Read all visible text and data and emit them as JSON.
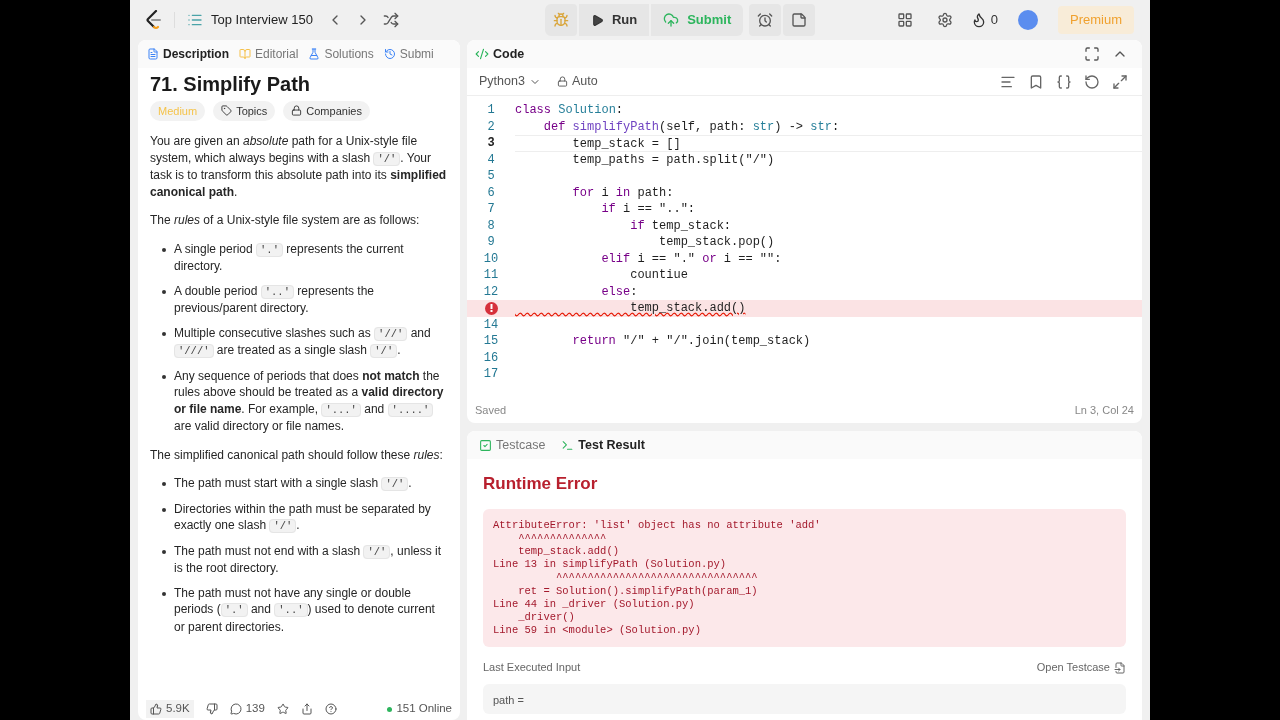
{
  "topbar": {
    "list_title": "Top Interview 150",
    "run": "Run",
    "submit": "Submit",
    "streak": "0",
    "premium": "Premium"
  },
  "description_panel": {
    "tabs": [
      {
        "label": "Description",
        "selected": true
      },
      {
        "label": "Editorial",
        "selected": false
      },
      {
        "label": "Solutions",
        "selected": false
      },
      {
        "label": "Submi",
        "selected": false
      }
    ],
    "title": "71. Simplify Path",
    "tags": [
      {
        "kind": "difficulty",
        "label": "Medium"
      },
      {
        "kind": "topics",
        "label": "Topics"
      },
      {
        "kind": "companies",
        "label": "Companies"
      }
    ],
    "blocks": [
      {
        "kind": "paragraph",
        "segments": [
          {
            "kind": "text",
            "text": "You are given an *absolute* path for a Unix-style file system, which always begins with a slash "
          },
          {
            "kind": "code",
            "text": "'/'"
          },
          {
            "kind": "text",
            "text": ". Your task is to transform this absolute path into its **simplified canonical path**."
          }
        ]
      },
      {
        "kind": "paragraph",
        "segments": [
          {
            "kind": "text",
            "text": "The *rules* of a Unix-style file system are as follows:"
          }
        ]
      },
      {
        "kind": "bullets",
        "items": [
          [
            {
              "kind": "text",
              "text": "A single period "
            },
            {
              "kind": "code",
              "text": "'.'"
            },
            {
              "kind": "text",
              "text": " represents the current directory."
            }
          ],
          [
            {
              "kind": "text",
              "text": "A double period "
            },
            {
              "kind": "code",
              "text": "'..'"
            },
            {
              "kind": "text",
              "text": " represents the previous/parent directory."
            }
          ],
          [
            {
              "kind": "text",
              "text": "Multiple consecutive slashes such as "
            },
            {
              "kind": "code",
              "text": "'//'"
            },
            {
              "kind": "text",
              "text": " and "
            },
            {
              "kind": "code",
              "text": "'///'"
            },
            {
              "kind": "text",
              "text": " are treated as a single slash "
            },
            {
              "kind": "code",
              "text": "'/'"
            },
            {
              "kind": "text",
              "text": "."
            }
          ],
          [
            {
              "kind": "text",
              "text": "Any sequence of periods that does **not match** the rules above should be treated as a **valid directory or file name**. For example, "
            },
            {
              "kind": "code",
              "text": "'...'"
            },
            {
              "kind": "text",
              "text": " and "
            },
            {
              "kind": "code",
              "text": "'....'"
            },
            {
              "kind": "text",
              "text": " are valid directory or file names."
            }
          ]
        ]
      },
      {
        "kind": "paragraph",
        "segments": [
          {
            "kind": "text",
            "text": "The simplified canonical path should follow these *rules*:"
          }
        ]
      },
      {
        "kind": "bullets",
        "items": [
          [
            {
              "kind": "text",
              "text": "The path must start with a single slash "
            },
            {
              "kind": "code",
              "text": "'/'"
            },
            {
              "kind": "text",
              "text": "."
            }
          ],
          [
            {
              "kind": "text",
              "text": "Directories within the path must be separated by exactly one slash "
            },
            {
              "kind": "code",
              "text": "'/'"
            },
            {
              "kind": "text",
              "text": "."
            }
          ],
          [
            {
              "kind": "text",
              "text": "The path must not end with a slash "
            },
            {
              "kind": "code",
              "text": "'/'"
            },
            {
              "kind": "text",
              "text": ", unless it is the root directory."
            }
          ],
          [
            {
              "kind": "text",
              "text": "The path must not have any single or double periods ("
            },
            {
              "kind": "code",
              "text": "'.'"
            },
            {
              "kind": "text",
              "text": " and "
            },
            {
              "kind": "code",
              "text": "'..'"
            },
            {
              "kind": "text",
              "text": ") used to denote current or parent directories."
            }
          ]
        ]
      }
    ],
    "footer": {
      "likes": "5.9K",
      "comments": "139",
      "online": "151 Online"
    }
  },
  "code_panel": {
    "title": "Code",
    "language": "Python3",
    "mode": "Auto",
    "lines": [
      {
        "number": "1",
        "current": false,
        "error": false,
        "tokens": [
          {
            "kind": "keyword",
            "text": "class "
          },
          {
            "kind": "type",
            "text": "Solution"
          },
          {
            "kind": "plain",
            "text": ":"
          }
        ]
      },
      {
        "number": "2",
        "current": false,
        "error": false,
        "tokens": [
          {
            "kind": "keyword",
            "text": "    def "
          },
          {
            "kind": "function",
            "text": "simplifyPath"
          },
          {
            "kind": "plain",
            "text": "(self, path: "
          },
          {
            "kind": "type",
            "text": "str"
          },
          {
            "kind": "plain",
            "text": ") -> "
          },
          {
            "kind": "type",
            "text": "str"
          },
          {
            "kind": "plain",
            "text": ":"
          }
        ]
      },
      {
        "number": "3",
        "current": true,
        "error": false,
        "tokens": [
          {
            "kind": "plain",
            "text": "        temp_stack = []"
          }
        ]
      },
      {
        "number": "4",
        "current": false,
        "error": false,
        "tokens": [
          {
            "kind": "plain",
            "text": "        temp_paths = path.split(\"/\")"
          }
        ]
      },
      {
        "number": "5",
        "current": false,
        "error": false
      },
      {
        "number": "6",
        "current": false,
        "error": false,
        "tokens": [
          {
            "kind": "keyword",
            "text": "        for "
          },
          {
            "kind": "plain",
            "text": "i "
          },
          {
            "kind": "keyword",
            "text": "in "
          },
          {
            "kind": "plain",
            "text": "path:"
          }
        ]
      },
      {
        "number": "7",
        "current": false,
        "error": false,
        "tokens": [
          {
            "kind": "keyword",
            "text": "            if "
          },
          {
            "kind": "plain",
            "text": "i == \"..\":"
          }
        ]
      },
      {
        "number": "8",
        "current": false,
        "error": false,
        "tokens": [
          {
            "kind": "keyword",
            "text": "                if "
          },
          {
            "kind": "plain",
            "text": "temp_stack:"
          }
        ]
      },
      {
        "number": "9",
        "current": false,
        "error": false,
        "tokens": [
          {
            "kind": "plain",
            "text": "                    temp_stack.pop()"
          }
        ]
      },
      {
        "number": "10",
        "current": false,
        "error": false,
        "tokens": [
          {
            "kind": "keyword",
            "text": "            elif "
          },
          {
            "kind": "plain",
            "text": "i == \".\" "
          },
          {
            "kind": "keyword",
            "text": "or "
          },
          {
            "kind": "plain",
            "text": "i == \"\":"
          }
        ]
      },
      {
        "number": "11",
        "current": false,
        "error": false,
        "tokens": [
          {
            "kind": "plain",
            "text": "                countiue"
          }
        ]
      },
      {
        "number": "12",
        "current": false,
        "error": false,
        "tokens": [
          {
            "kind": "keyword",
            "text": "            else"
          },
          {
            "kind": "plain",
            "text": ":"
          }
        ]
      },
      {
        "current": false,
        "error": true,
        "tokens": [
          {
            "kind": "plain",
            "text": "                temp_stack.add()"
          }
        ]
      },
      {
        "number": "14",
        "current": false,
        "error": false
      },
      {
        "number": "15",
        "current": false,
        "error": false,
        "tokens": [
          {
            "kind": "keyword",
            "text": "        return "
          },
          {
            "kind": "plain",
            "text": "\"/\" + \"/\".join(temp_stack)"
          }
        ]
      },
      {
        "number": "16",
        "current": false,
        "error": false
      },
      {
        "number": "17",
        "current": false,
        "error": false
      }
    ],
    "status": "Saved",
    "cursor": "Ln 3, Col 24"
  },
  "result_panel": {
    "tabs": [
      {
        "label": "Testcase",
        "selected": false
      },
      {
        "label": "Test Result",
        "selected": true
      }
    ],
    "heading": "Runtime Error",
    "error_lines": [
      "AttributeError: 'list' object has no attribute 'add'",
      "    ^^^^^^^^^^^^^^",
      "    temp_stack.add()",
      "Line 13 in simplifyPath (Solution.py)",
      "          ^^^^^^^^^^^^^^^^^^^^^^^^^^^^^^^^",
      "    ret = Solution().simplifyPath(param_1)",
      "Line 44 in _driver (Solution.py)",
      "    _driver()",
      "Line 59 in <module> (Solution.py)"
    ],
    "input_label": "Last Executed Input",
    "open_testcase": "Open Testcase",
    "input_value": "path ="
  }
}
